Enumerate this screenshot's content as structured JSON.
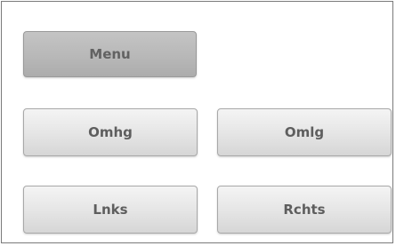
{
  "buttons": {
    "menu": "Menu",
    "up": "Omhg",
    "down": "Omlg",
    "left": "Lnks",
    "right": "Rchts"
  },
  "colors": {
    "button_face": "#e6e6e6",
    "menu_face": "#b8b8b8",
    "label": "#5e5e5e",
    "frame_border": "#7a7a7a"
  }
}
